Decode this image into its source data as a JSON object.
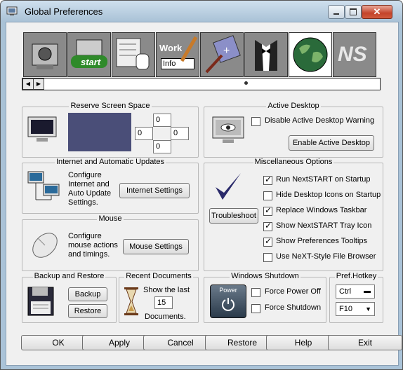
{
  "window": {
    "title": "Global Preferences"
  },
  "tabs": [
    {
      "name": "general",
      "label": ""
    },
    {
      "name": "start-menu",
      "label": "start"
    },
    {
      "name": "menu-editor",
      "label": ""
    },
    {
      "name": "workplace",
      "label_top": "Work",
      "label_bottom": "Info"
    },
    {
      "name": "appearance",
      "label": ""
    },
    {
      "name": "skins",
      "label": ""
    },
    {
      "name": "global",
      "label": ""
    },
    {
      "name": "ns",
      "label": "NS"
    }
  ],
  "reserve": {
    "title": "Reserve Screen Space",
    "top": "0",
    "left": "0",
    "right": "0",
    "bottom": "0"
  },
  "active_desktop": {
    "title": "Active Desktop",
    "disable_label": "Disable Active Desktop Warning",
    "disable_checked": false,
    "enable_button": "Enable Active Desktop"
  },
  "updates": {
    "title": "Internet and Automatic Updates",
    "desc": [
      "Configure",
      "Internet and",
      "Auto Update",
      "Settings."
    ],
    "button": "Internet Settings"
  },
  "misc": {
    "title": "Miscellaneous Options",
    "troubleshoot": "Troubleshoot",
    "options": [
      {
        "label": "Run NextSTART on Startup",
        "checked": true
      },
      {
        "label": "Hide Desktop Icons on Startup",
        "checked": false
      },
      {
        "label": "Replace Windows Taskbar",
        "checked": true
      },
      {
        "label": "Show NextSTART Tray Icon",
        "checked": true
      },
      {
        "label": "Show Preferences Tooltips",
        "checked": true
      },
      {
        "label": "Use NeXT-Style File Browser",
        "checked": false
      }
    ]
  },
  "mouse": {
    "title": "Mouse",
    "desc": [
      "Configure",
      "mouse actions",
      "and timings."
    ],
    "button": "Mouse Settings"
  },
  "backup": {
    "title": "Backup and Restore",
    "backup_button": "Backup",
    "restore_button": "Restore"
  },
  "recent": {
    "title": "Recent Documents",
    "line1": "Show the last",
    "value": "15",
    "line2": "Documents."
  },
  "shutdown": {
    "title": "Windows Shutdown",
    "power_label": "Power",
    "force_poweroff": "Force Power Off",
    "force_shutdown": "Force Shutdown"
  },
  "hotkey": {
    "title": "Pref.Hotkey",
    "modifier": "Ctrl",
    "key": "F10"
  },
  "buttons": {
    "ok": "OK",
    "apply": "Apply",
    "cancel": "Cancel",
    "restore": "Restore",
    "help": "Help",
    "exit": "Exit"
  }
}
